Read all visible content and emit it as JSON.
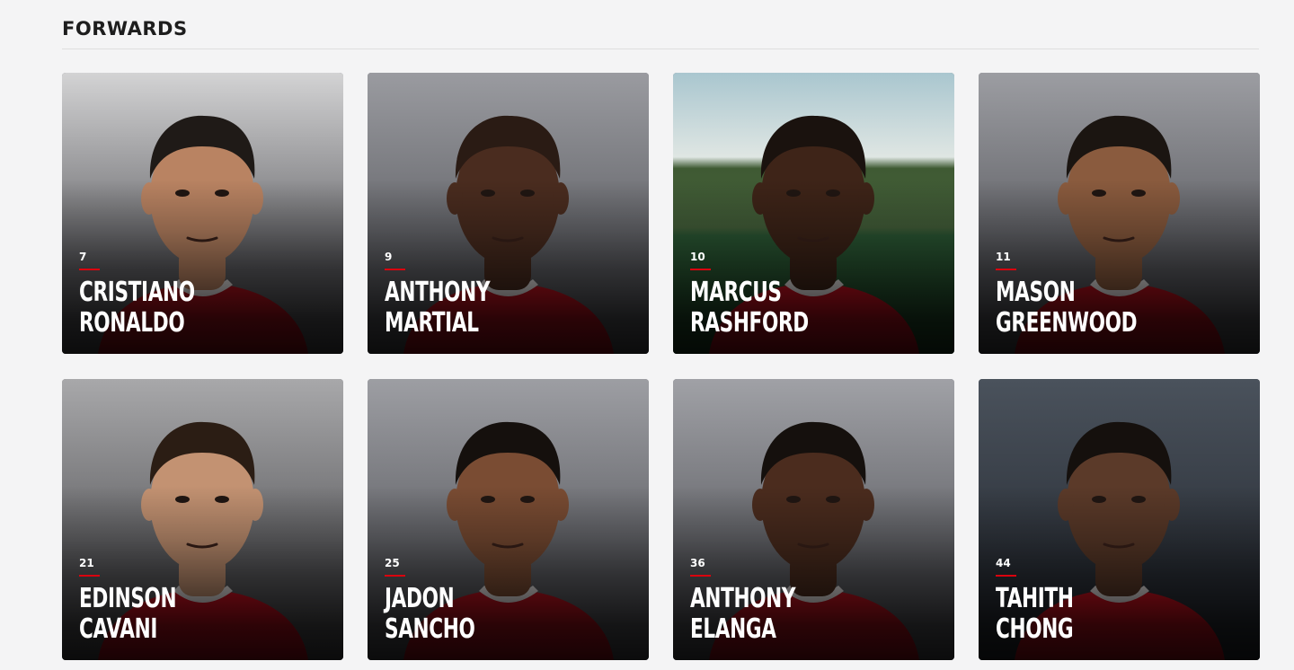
{
  "section": {
    "title": "FORWARDS"
  },
  "players": [
    {
      "number": "7",
      "first": "CRISTIANO",
      "last": "RONALDO",
      "bg": "#5f5f63",
      "bg_top": "#d3d3d4",
      "skin": "#b98362",
      "hair": "#1f1a17",
      "shirt": "#b3111d",
      "scene": "studio"
    },
    {
      "number": "9",
      "first": "ANTHONY",
      "last": "MARTIAL",
      "bg": "#5d5e63",
      "bg_top": "#9a9ba0",
      "skin": "#4a2c1f",
      "hair": "#2a1b14",
      "shirt": "#c1121f",
      "scene": "studio"
    },
    {
      "number": "10",
      "first": "MARCUS",
      "last": "RASHFORD",
      "bg": "#2c5a35",
      "bg_top": "#a9c6cf",
      "skin": "#3e2418",
      "hair": "#1a120e",
      "shirt": "#c8101f",
      "scene": "pitch"
    },
    {
      "number": "11",
      "first": "MASON",
      "last": "GREENWOOD",
      "bg": "#58595e",
      "bg_top": "#9c9da2",
      "skin": "#8a5b3e",
      "hair": "#1b1511",
      "shirt": "#b8101c",
      "scene": "studio"
    },
    {
      "number": "21",
      "first": "EDINSON",
      "last": "CAVANI",
      "bg": "#5a5a5d",
      "bg_top": "#a8a8aa",
      "skin": "#c39272",
      "hair": "#2b1d14",
      "shirt": "#cf1020",
      "scene": "studio"
    },
    {
      "number": "25",
      "first": "JADON",
      "last": "SANCHO",
      "bg": "#5c5d62",
      "bg_top": "#9d9ea3",
      "skin": "#7a4c33",
      "hair": "#15100d",
      "shirt": "#c1121f",
      "scene": "studio"
    },
    {
      "number": "36",
      "first": "ANTHONY",
      "last": "ELANGA",
      "bg": "#5c5d62",
      "bg_top": "#a0a1a6",
      "skin": "#4b2c1e",
      "hair": "#15100d",
      "shirt": "#c1121f",
      "scene": "studio"
    },
    {
      "number": "44",
      "first": "TAHITH",
      "last": "CHONG",
      "bg": "#2c3139",
      "bg_top": "#4a525c",
      "skin": "#5b3a29",
      "hair": "#15100d",
      "shirt": "#d1111f",
      "scene": "stadium"
    }
  ]
}
